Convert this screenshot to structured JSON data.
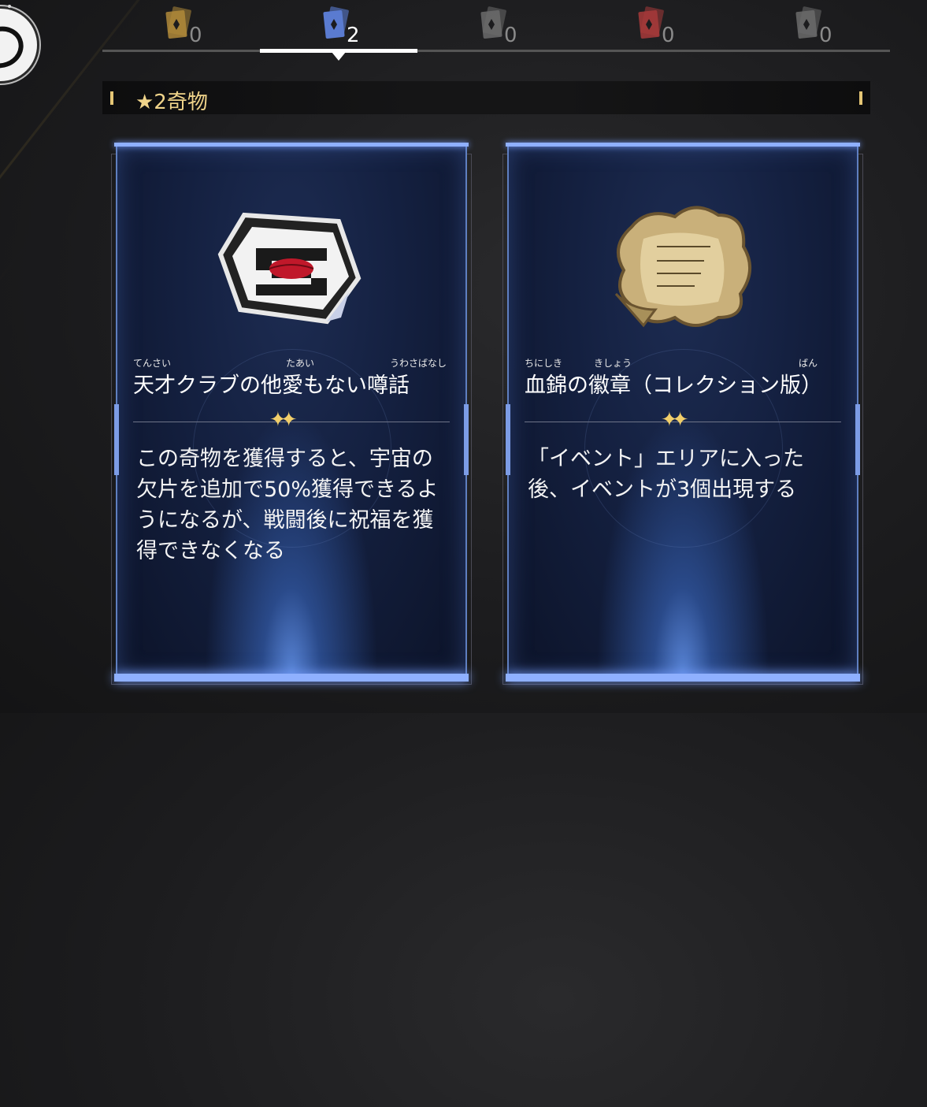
{
  "tabs": [
    {
      "count": "0",
      "icon": "card-icon-gold",
      "color": "#b08a3a",
      "active": false
    },
    {
      "count": "2",
      "icon": "card-icon-blue",
      "color": "#5a7bd0",
      "active": true
    },
    {
      "count": "0",
      "icon": "card-icon-gray",
      "color": "#6b6b6b",
      "active": false
    },
    {
      "count": "0",
      "icon": "card-icon-red",
      "color": "#a83a3a",
      "active": false
    },
    {
      "count": "0",
      "icon": "card-icon-gray",
      "color": "#6b6b6b",
      "active": false
    }
  ],
  "section": {
    "title": "★2奇物"
  },
  "cards": [
    {
      "furigana": [
        "てんさい",
        "たあい",
        "うわさばなし"
      ],
      "name": "天才クラブの他愛もない噂話",
      "sparkle": "✦✦",
      "description": "この奇物を獲得すると、宇宙の欠片を追加で50%獲得できるようになるが、戦闘後に祝福を獲得できなくなる"
    },
    {
      "furigana": [
        "ちにしき",
        "きしょう",
        "ばん"
      ],
      "name": "血錦の徽章（コレクション版）",
      "sparkle": "✦✦",
      "description": "「イベント」エリアに入った後、イベントが3個出現する"
    }
  ],
  "colors": {
    "accent_gold": "#f0d48a",
    "card_border": "#8fb0ff",
    "tab_active": "#ffffff"
  }
}
